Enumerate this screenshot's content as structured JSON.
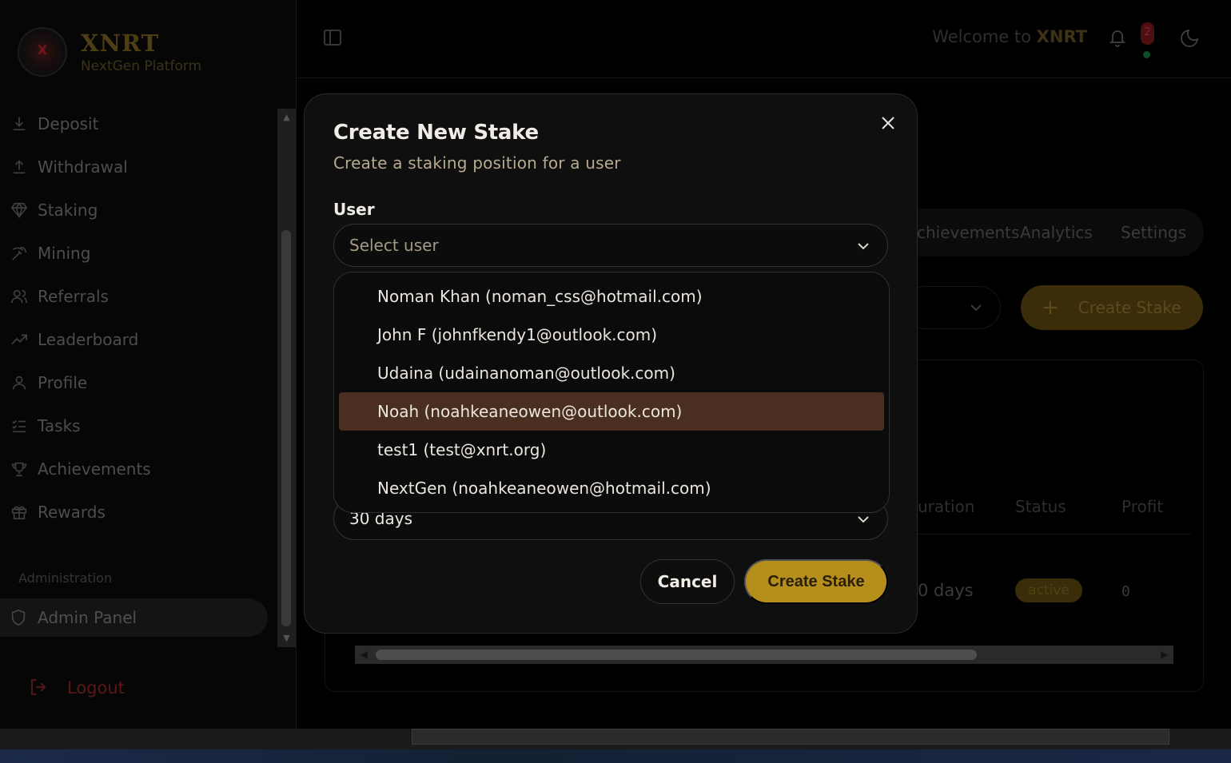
{
  "brand": {
    "name": "XNRT",
    "tagline": "NextGen Platform",
    "logo_text": "XNRT"
  },
  "sidebar": {
    "items": [
      {
        "label": "Deposit",
        "icon": "download-icon"
      },
      {
        "label": "Withdrawal",
        "icon": "upload-icon"
      },
      {
        "label": "Staking",
        "icon": "gem-icon"
      },
      {
        "label": "Mining",
        "icon": "pickaxe-icon"
      },
      {
        "label": "Referrals",
        "icon": "users-icon"
      },
      {
        "label": "Leaderboard",
        "icon": "trending-up-icon"
      },
      {
        "label": "Profile",
        "icon": "user-icon"
      },
      {
        "label": "Tasks",
        "icon": "list-checks-icon"
      },
      {
        "label": "Achievements",
        "icon": "trophy-icon"
      },
      {
        "label": "Rewards",
        "icon": "gift-icon"
      }
    ],
    "admin_heading": "Administration",
    "admin_item": "Admin Panel",
    "logout": "Logout"
  },
  "header": {
    "welcome_prefix": "Welcome to ",
    "welcome_brand": "XNRT",
    "notification_count": "2"
  },
  "background": {
    "tabs": [
      "chievements",
      "Analytics",
      "Settings"
    ],
    "create_stake": "Create Stake",
    "columns": [
      "uration",
      "Status",
      "Profit"
    ],
    "row": {
      "duration": "0 days",
      "status": "active",
      "profit": "0"
    }
  },
  "modal": {
    "title": "Create New Stake",
    "description": "Create a staking position for a user",
    "user_label": "User",
    "user_placeholder": "Select user",
    "duration_value": "30 days",
    "cancel_label": "Cancel",
    "submit_label": "Create Stake"
  },
  "dropdown": {
    "options": [
      "Noman Khan (noman_css@hotmail.com)",
      "John F (johnfkendy1@outlook.com)",
      "Udaina (udainanoman@outlook.com)",
      "Noah (noahkeaneowen@outlook.com)",
      "test1 (test@xnrt.org)",
      "NextGen (noahkeaneowen@hotmail.com)"
    ],
    "highlighted_index": 3
  },
  "colors": {
    "accent": "#b68e1c",
    "highlight": "#4a2e1f",
    "background": "#000000",
    "modal": "#0f0f0f"
  }
}
